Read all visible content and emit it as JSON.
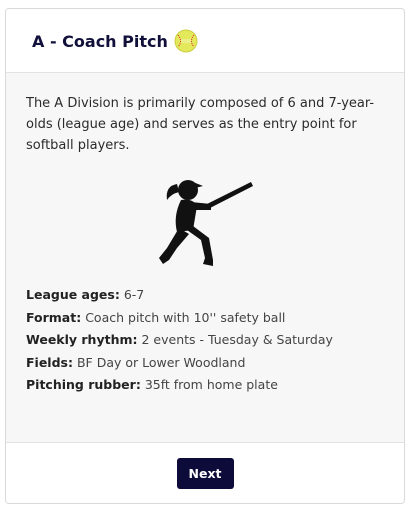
{
  "card": {
    "title": "A - Coach Pitch",
    "ball_icon": "softball-icon",
    "intro": "The A Division is primarily composed of 6 and 7-year-olds (league age) and serves as the entry point for softball players.",
    "illustration_icon": "batter-silhouette-icon",
    "details": [
      {
        "label": "League ages:",
        "value": "6-7"
      },
      {
        "label": "Format:",
        "value": "Coach pitch with 10'' safety ball"
      },
      {
        "label": "Weekly rhythm:",
        "value": "2 events - Tuesday & Saturday"
      },
      {
        "label": "Fields:",
        "value": "BF Day or Lower Woodland"
      },
      {
        "label": "Pitching rubber:",
        "value": "35ft from home plate"
      }
    ],
    "next_label": "Next"
  },
  "colors": {
    "primary": "#0d0b3a",
    "card_bg": "#f7f7f7",
    "ball": "#e3e95a"
  }
}
